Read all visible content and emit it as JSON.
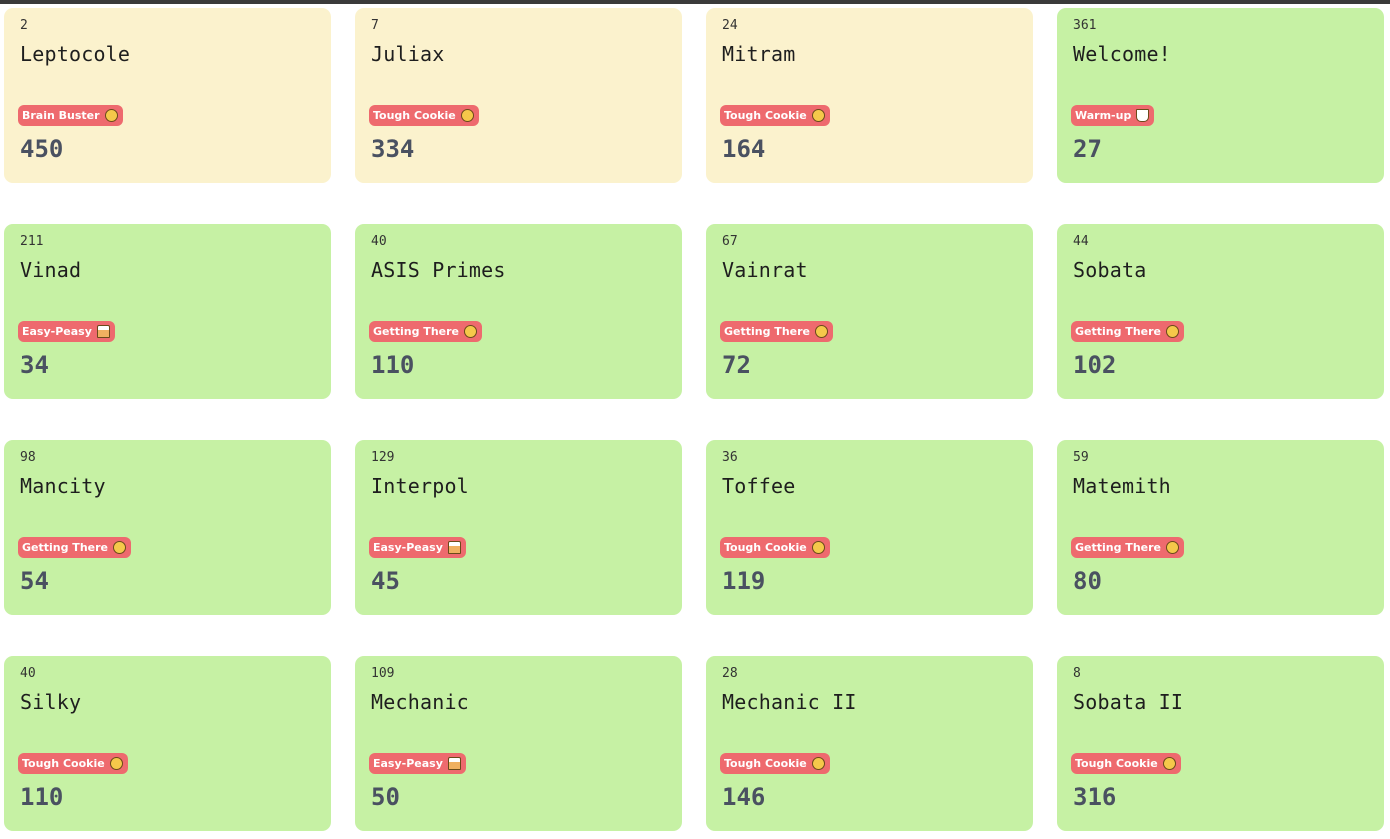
{
  "challenges": [
    {
      "solvers": "2",
      "name": "Leptocole",
      "difficulty": "Brain Buster",
      "difficulty_icon": "mind-blown-emoji-icon",
      "points": "450",
      "status": "unsolved"
    },
    {
      "solvers": "7",
      "name": "Juliax",
      "difficulty": "Tough Cookie",
      "difficulty_icon": "weary-face-emoji-icon",
      "points": "334",
      "status": "unsolved"
    },
    {
      "solvers": "24",
      "name": "Mitram",
      "difficulty": "Tough Cookie",
      "difficulty_icon": "weary-face-emoji-icon",
      "points": "164",
      "status": "unsolved"
    },
    {
      "solvers": "361",
      "name": "Welcome!",
      "difficulty": "Warm-up",
      "difficulty_icon": "hot-beverage-emoji-icon",
      "points": "27",
      "status": "solved"
    },
    {
      "solvers": "211",
      "name": "Vinad",
      "difficulty": "Easy-Peasy",
      "difficulty_icon": "cake-emoji-icon",
      "points": "34",
      "status": "solved"
    },
    {
      "solvers": "40",
      "name": "ASIS Primes",
      "difficulty": "Getting There",
      "difficulty_icon": "nerd-face-emoji-icon",
      "points": "110",
      "status": "solved"
    },
    {
      "solvers": "67",
      "name": "Vainrat",
      "difficulty": "Getting There",
      "difficulty_icon": "nerd-face-emoji-icon",
      "points": "72",
      "status": "solved"
    },
    {
      "solvers": "44",
      "name": "Sobata",
      "difficulty": "Getting There",
      "difficulty_icon": "nerd-face-emoji-icon",
      "points": "102",
      "status": "solved"
    },
    {
      "solvers": "98",
      "name": "Mancity",
      "difficulty": "Getting There",
      "difficulty_icon": "nerd-face-emoji-icon",
      "points": "54",
      "status": "solved"
    },
    {
      "solvers": "129",
      "name": "Interpol",
      "difficulty": "Easy-Peasy",
      "difficulty_icon": "cake-emoji-icon",
      "points": "45",
      "status": "solved"
    },
    {
      "solvers": "36",
      "name": "Toffee",
      "difficulty": "Tough Cookie",
      "difficulty_icon": "weary-face-emoji-icon",
      "points": "119",
      "status": "solved"
    },
    {
      "solvers": "59",
      "name": "Matemith",
      "difficulty": "Getting There",
      "difficulty_icon": "nerd-face-emoji-icon",
      "points": "80",
      "status": "solved"
    },
    {
      "solvers": "40",
      "name": "Silky",
      "difficulty": "Tough Cookie",
      "difficulty_icon": "weary-face-emoji-icon",
      "points": "110",
      "status": "solved"
    },
    {
      "solvers": "109",
      "name": "Mechanic",
      "difficulty": "Easy-Peasy",
      "difficulty_icon": "cake-emoji-icon",
      "points": "50",
      "status": "solved"
    },
    {
      "solvers": "28",
      "name": "Mechanic II",
      "difficulty": "Tough Cookie",
      "difficulty_icon": "weary-face-emoji-icon",
      "points": "146",
      "status": "solved"
    },
    {
      "solvers": "8",
      "name": "Sobata II",
      "difficulty": "Tough Cookie",
      "difficulty_icon": "weary-face-emoji-icon",
      "points": "316",
      "status": "solved"
    }
  ],
  "colors": {
    "unsolved_card": "#fbf2cd",
    "solved_card": "#c6f1a4",
    "badge": "#ee6a6e",
    "points_text": "#4a5161"
  }
}
